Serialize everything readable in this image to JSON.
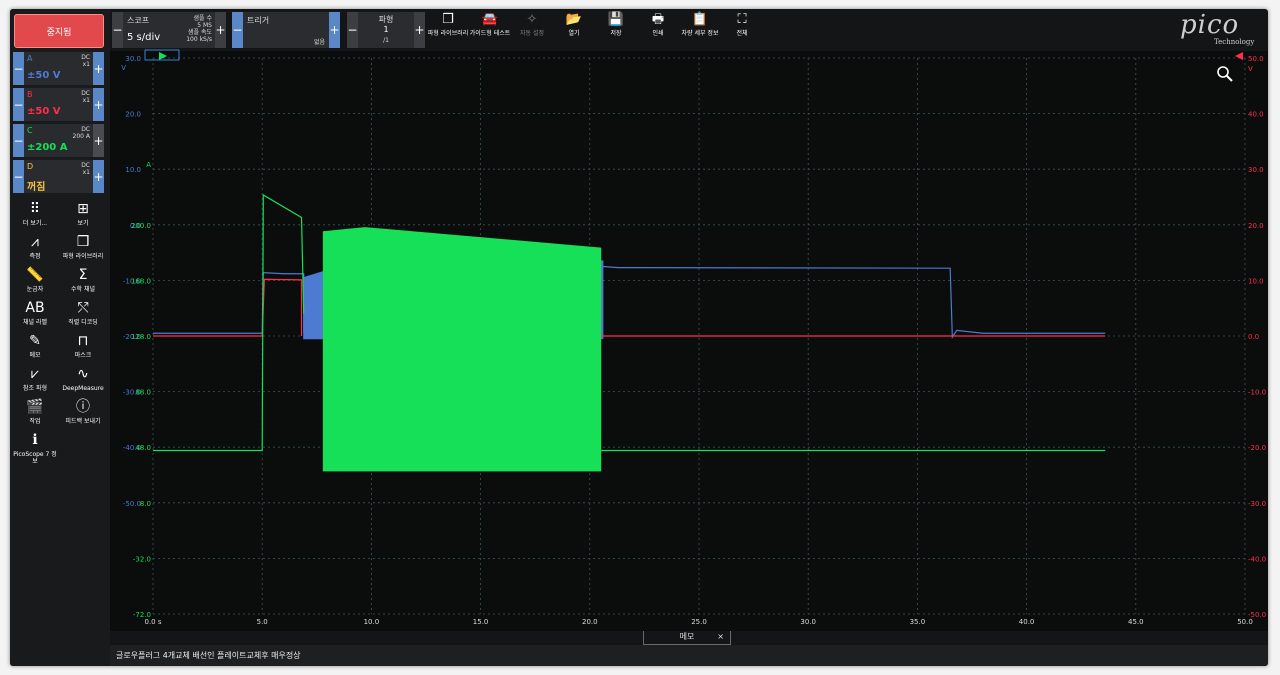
{
  "colors": {
    "A": "#4c7bd1",
    "B": "#ff2e4c",
    "C": "#16e058",
    "D": "#f5c542",
    "grid": "#3b5560",
    "accent": "#5a87c8"
  },
  "sidebar": {
    "stop_label": "중지됨",
    "channels": [
      {
        "name": "A",
        "mode": "DC",
        "probe": "x1",
        "range": "±50 V"
      },
      {
        "name": "B",
        "mode": "DC",
        "probe": "x1",
        "range": "±50 V"
      },
      {
        "name": "C",
        "mode": "DC",
        "probe": "200 A",
        "range": "±200 A"
      },
      {
        "name": "D",
        "mode": "DC",
        "probe": "x1",
        "range": "꺼짐"
      }
    ],
    "tools": [
      {
        "icon": "more-views-icon",
        "glyph": "⠿",
        "label": "더 보기..."
      },
      {
        "icon": "view-grid-icon",
        "glyph": "⊞",
        "label": "보기"
      },
      {
        "icon": "measure-icon",
        "glyph": "⩘",
        "label": "측정"
      },
      {
        "icon": "waveform-library-icon",
        "glyph": "❒",
        "label": "파형 라이브러리"
      },
      {
        "icon": "ruler-icon",
        "glyph": "📏",
        "label": "눈금자"
      },
      {
        "icon": "math-channel-icon",
        "glyph": "Σ",
        "label": "수학 채널"
      },
      {
        "icon": "channel-label-icon",
        "glyph": "AB",
        "label": "채널 라벨"
      },
      {
        "icon": "serial-decode-icon",
        "glyph": "⤲",
        "label": "직렬 디코딩"
      },
      {
        "icon": "memo-icon",
        "glyph": "✎",
        "label": "메모"
      },
      {
        "icon": "mask-icon",
        "glyph": "⊓",
        "label": "마스크"
      },
      {
        "icon": "reference-waveform-icon",
        "glyph": "⩗",
        "label": "참조 파형"
      },
      {
        "icon": "deep-measure-icon",
        "glyph": "∿",
        "label": "DeepMeasure"
      },
      {
        "icon": "action-icon",
        "glyph": "🎬",
        "label": "작업"
      },
      {
        "icon": "feedback-icon",
        "glyph": "ⓘ",
        "label": "피드백 보내기"
      },
      {
        "icon": "picoscope-info-icon",
        "glyph": "ℹ",
        "label": "PicoScope 7 정보"
      }
    ]
  },
  "toolbar": {
    "scope_title": "스코프",
    "timebase": "5 s/div",
    "samples_label": "샘플 수",
    "samples_value": "5 MS",
    "rate_label": "샘플 속도",
    "rate_value": "100 kS/s",
    "trigger_title": "트리거",
    "trigger_value": "없음",
    "waveform_title": "파형",
    "waveform_index": "1",
    "waveform_total": "/1",
    "buttons": [
      {
        "icon": "waveform-library-icon",
        "glyph": "❒",
        "label": "파형 라이브러리",
        "enabled": true
      },
      {
        "icon": "guided-test-icon",
        "glyph": "🚘",
        "label": "가이드형 테스트",
        "enabled": true
      },
      {
        "icon": "auto-setup-icon",
        "glyph": "✧",
        "label": "자동 설정",
        "enabled": false
      },
      {
        "icon": "open-folder-icon",
        "glyph": "📂",
        "label": "열기",
        "enabled": true
      },
      {
        "icon": "save-icon",
        "glyph": "💾",
        "label": "저장",
        "enabled": true
      },
      {
        "icon": "print-icon",
        "glyph": "🖶",
        "label": "인쇄",
        "enabled": true
      },
      {
        "icon": "vehicle-details-icon",
        "glyph": "📋",
        "label": "차량 세부 정보",
        "enabled": true
      },
      {
        "icon": "fullscreen-icon",
        "glyph": "⛶",
        "label": "전체",
        "enabled": true
      }
    ],
    "logo_text": "pico",
    "logo_subtext": "Technology"
  },
  "plot": {
    "x_ticks": [
      "0.0 s",
      "5.0",
      "10.0",
      "15.0",
      "20.0",
      "25.0",
      "30.0",
      "35.0",
      "40.0",
      "45.0",
      "50.0"
    ],
    "left_axis_a": [
      "30.0",
      "20.0",
      "10.0",
      "0.0",
      "-10.0",
      "-20.0",
      "-30.0",
      "-40.0",
      "-50.0"
    ],
    "left_axis_a_unit": "V",
    "left_axis_c": [
      "A",
      "200.0",
      "168.0",
      "128.0",
      "88.0",
      "48.0",
      "8.0",
      "-32.0",
      "-72.0"
    ],
    "right_axis_b": [
      "50.0",
      "40.0",
      "30.0",
      "20.0",
      "10.0",
      "0.0",
      "-10.0",
      "-20.0",
      "-30.0",
      "-40.0",
      "-50.0"
    ],
    "right_axis_b_unit": "V",
    "zoom_icon": "zoom-icon"
  },
  "notes": {
    "tab_label": "메모",
    "close_glyph": "×",
    "text": "글로우플러그 4개교체 배선인 플레이트교체후 매우정상"
  },
  "chart_data": {
    "type": "line",
    "x_unit": "s",
    "xlim": [
      0,
      50
    ],
    "series": [
      {
        "name": "A",
        "unit": "V",
        "ylim": [
          -50,
          50
        ],
        "baseline": [
          [
            0,
            0.5
          ],
          [
            5,
            0.5
          ],
          [
            5.05,
            11.4
          ],
          [
            6,
            11.2
          ],
          [
            6.9,
            11.2
          ],
          [
            6.9,
            0.5
          ]
        ],
        "envelope": {
          "x0": 6.9,
          "x1": 20.6,
          "upper_start": 10.5,
          "upper_peak": 13.0,
          "upper_end": 13.5,
          "lower": -0.5
        },
        "after": [
          [
            20.6,
            12.5
          ],
          [
            21.3,
            12.3
          ],
          [
            36.5,
            12.2
          ],
          [
            36.6,
            -0.2
          ],
          [
            36.8,
            1.0
          ],
          [
            38,
            0.5
          ],
          [
            43.6,
            0.5
          ]
        ]
      },
      {
        "name": "B",
        "unit": "V",
        "ylim": [
          -50,
          50
        ],
        "baseline": [
          [
            0,
            0
          ],
          [
            5,
            0
          ],
          [
            5.1,
            10.2
          ],
          [
            6.8,
            10.1
          ],
          [
            6.8,
            0
          ]
        ],
        "envelope": {
          "x0": 7.8,
          "x1": 20.5,
          "upper_start": 9.8,
          "upper_peak": 10.4,
          "upper_end": 11.1,
          "lower": 0
        },
        "after": [
          [
            20.5,
            0
          ],
          [
            43.6,
            0
          ]
        ]
      },
      {
        "name": "C",
        "unit": "A",
        "ylim": [
          -72,
          200
        ],
        "baseline": [
          [
            0,
            8
          ],
          [
            5,
            8
          ],
          [
            5.05,
            133
          ],
          [
            6.8,
            122
          ],
          [
            6.9,
            75
          ]
        ],
        "envelope": {
          "x0": 7.8,
          "x1": 20.5,
          "upper_start": 115,
          "upper_peak": 117,
          "upper_end": 107,
          "lower": -2
        },
        "after": [
          [
            20.5,
            8
          ],
          [
            43.6,
            8
          ]
        ]
      }
    ]
  }
}
